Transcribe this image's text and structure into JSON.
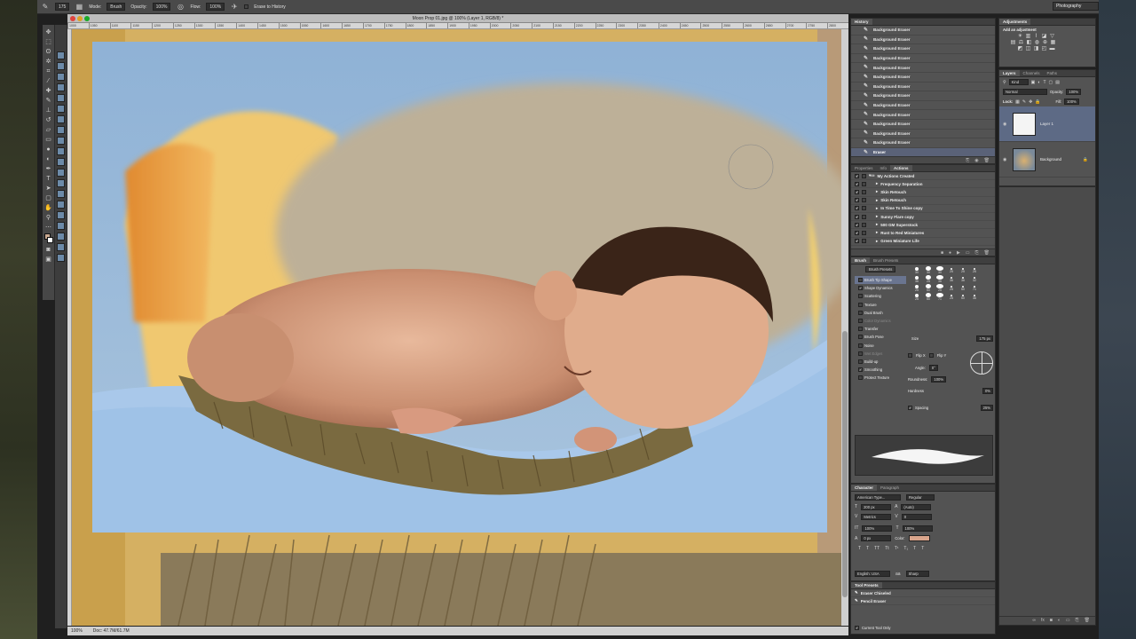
{
  "app": {
    "workspace": "Photography"
  },
  "options_bar": {
    "brush_size": "175",
    "mode_label": "Mode:",
    "mode_value": "Brush",
    "opacity_label": "Opacity:",
    "opacity_value": "100%",
    "flow_label": "Flow:",
    "flow_value": "100%",
    "erase_history_label": "Erase to History"
  },
  "document": {
    "title": "Moon Prop 01.jpg @ 100% (Layer 1, RGB/8) *",
    "ruler_ticks": [
      "1000",
      "1050",
      "1100",
      "1150",
      "1200",
      "1250",
      "1300",
      "1350",
      "1400",
      "1450",
      "1500",
      "1550",
      "1600",
      "1650",
      "1700",
      "1750",
      "1800",
      "1850",
      "1900",
      "1950",
      "2000",
      "2050",
      "2100",
      "2150",
      "2200",
      "2250",
      "2300",
      "2350",
      "2400",
      "2450",
      "2500",
      "2550",
      "2600",
      "2650",
      "2700",
      "2750",
      "2800"
    ],
    "zoom": "100%",
    "doc_size": "Doc: 47.7M/61.7M"
  },
  "colors": {
    "foreground": "#c8a890",
    "background": "#ffffff",
    "selection": "#5a6278",
    "swatch": "#d9a58c"
  },
  "history": {
    "tab": "History",
    "items": [
      "Background Eraser",
      "Background Eraser",
      "Background Eraser",
      "Background Eraser",
      "Background Eraser",
      "Background Eraser",
      "Background Eraser",
      "Background Eraser",
      "Background Eraser",
      "Background Eraser",
      "Background Eraser",
      "Background Eraser",
      "Background Eraser"
    ],
    "current": "Eraser"
  },
  "actions": {
    "tabs": [
      "Properties",
      "Info",
      "Actions"
    ],
    "set_name": "My Actions Created",
    "items": [
      "Frequency Separation",
      "Skin Retouch",
      "Skin Retouch",
      "In Time To Shine copy",
      "Sunny Flare copy",
      "500 GM Superstock",
      "Rust to Red Miniatures",
      "Green Miniature Life"
    ]
  },
  "brush": {
    "tabs": [
      "Brush",
      "Brush Presets"
    ],
    "presets_button": "Brush Presets",
    "options": [
      {
        "label": "Brush Tip Shape",
        "checked": false,
        "dim": false,
        "sel": true
      },
      {
        "label": "Shape Dynamics",
        "checked": true,
        "dim": false,
        "sel": false
      },
      {
        "label": "Scattering",
        "checked": false,
        "dim": false,
        "sel": false
      },
      {
        "label": "Texture",
        "checked": false,
        "dim": false,
        "sel": false
      },
      {
        "label": "Dual Brush",
        "checked": false,
        "dim": false,
        "sel": false
      },
      {
        "label": "Color Dynamics",
        "checked": false,
        "dim": true,
        "sel": false
      },
      {
        "label": "Transfer",
        "checked": false,
        "dim": false,
        "sel": false
      },
      {
        "label": "Brush Pose",
        "checked": false,
        "dim": false,
        "sel": false
      },
      {
        "label": "Noise",
        "checked": false,
        "dim": false,
        "sel": false
      },
      {
        "label": "Wet Edges",
        "checked": false,
        "dim": true,
        "sel": false
      },
      {
        "label": "Build-up",
        "checked": false,
        "dim": false,
        "sel": false
      },
      {
        "label": "Smoothing",
        "checked": true,
        "dim": false,
        "sel": false
      },
      {
        "label": "Protect Texture",
        "checked": false,
        "dim": false,
        "sel": false
      }
    ],
    "tip_sizes": [
      "30",
      "30",
      "30",
      "25",
      "25",
      "25",
      "36",
      "25",
      "36",
      "36",
      "36",
      "32",
      "25",
      "50",
      "25",
      "25",
      "50",
      "71",
      "25",
      "50",
      "71",
      "25",
      "50",
      "36"
    ],
    "size_label": "Size",
    "size_value": "175 px",
    "flip_x": "Flip X",
    "flip_y": "Flip Y",
    "angle_label": "Angle:",
    "angle_value": "0°",
    "roundness_label": "Roundness:",
    "roundness_value": "100%",
    "hardness_label": "Hardness",
    "hardness_value": "0%",
    "spacing_label": "Spacing",
    "spacing_value": "25%"
  },
  "character": {
    "tabs": [
      "Character",
      "Paragraph"
    ],
    "font_family": "American Type...",
    "font_style": "Regular",
    "font_size": "200 px",
    "leading": "(Auto)",
    "kerning": "Metrics",
    "tracking": "0",
    "vscale": "100%",
    "hscale": "100%",
    "baseline": "0 px",
    "color_label": "Color:",
    "language": "English: USA",
    "aa": "Sharp",
    "styles": [
      "T",
      "T",
      "TT",
      "Tt",
      "T¹",
      "T₁",
      "T",
      "T"
    ]
  },
  "tool_presets": {
    "tab": "Tool Presets",
    "items": [
      "Eraser Chiseled",
      "Pencil Eraser"
    ],
    "current_only": "Current Tool Only"
  },
  "adjustments": {
    "tab": "Adjustments",
    "add_label": "Add an adjustment"
  },
  "layers": {
    "tabs": [
      "Layers",
      "Channels",
      "Paths"
    ],
    "kind": "Kind",
    "blend": "Normal",
    "opacity_label": "Opacity:",
    "opacity_value": "100%",
    "lock_label": "Lock:",
    "fill_label": "Fill:",
    "fill_value": "100%",
    "items": [
      "Layer 1",
      "Background"
    ]
  }
}
